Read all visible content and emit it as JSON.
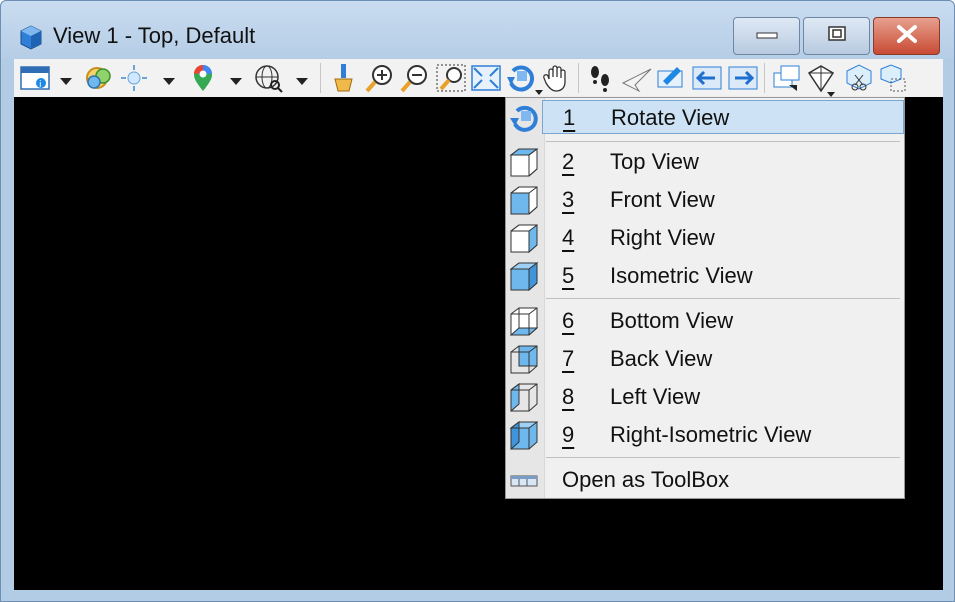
{
  "window": {
    "title": "View 1 - Top, Default",
    "controls": {
      "minimize": "minimize-icon",
      "maximize": "maximize-icon",
      "close": "close-icon"
    }
  },
  "toolbar": {
    "tools": [
      "view-attributes-icon",
      "display-style-icon",
      "lighting-icon",
      "location-icon",
      "globe-icon",
      "update-view-icon",
      "zoom-in-icon",
      "zoom-out-icon",
      "window-area-icon",
      "fit-view-icon",
      "rotate-view-icon",
      "pan-view-icon",
      "walk-icon",
      "fly-icon",
      "view-previous-icon",
      "view-next-icon",
      "copy-view-icon",
      "camera-icon",
      "clip-volume-icon",
      "clip-mask-icon"
    ]
  },
  "menu": {
    "items": [
      {
        "num": "1",
        "label": "Rotate View",
        "icon": "rotate-view-icon"
      },
      {
        "num": "2",
        "label": "Top View",
        "icon": "cube-top-icon"
      },
      {
        "num": "3",
        "label": "Front View",
        "icon": "cube-front-icon"
      },
      {
        "num": "4",
        "label": "Right View",
        "icon": "cube-right-icon"
      },
      {
        "num": "5",
        "label": "Isometric View",
        "icon": "cube-iso-icon"
      },
      {
        "num": "6",
        "label": "Bottom View",
        "icon": "cube-bottom-icon"
      },
      {
        "num": "7",
        "label": "Back View",
        "icon": "cube-back-icon"
      },
      {
        "num": "8",
        "label": "Left View",
        "icon": "cube-left-icon"
      },
      {
        "num": "9",
        "label": "Right-Isometric View",
        "icon": "cube-right-iso-icon"
      }
    ],
    "toolbox": {
      "label": "Open as ToolBox",
      "icon": "toolbox-icon"
    }
  },
  "colors": {
    "viewport": "#000000",
    "accent": "#1e88e5",
    "highlight": "#cde3f5"
  }
}
